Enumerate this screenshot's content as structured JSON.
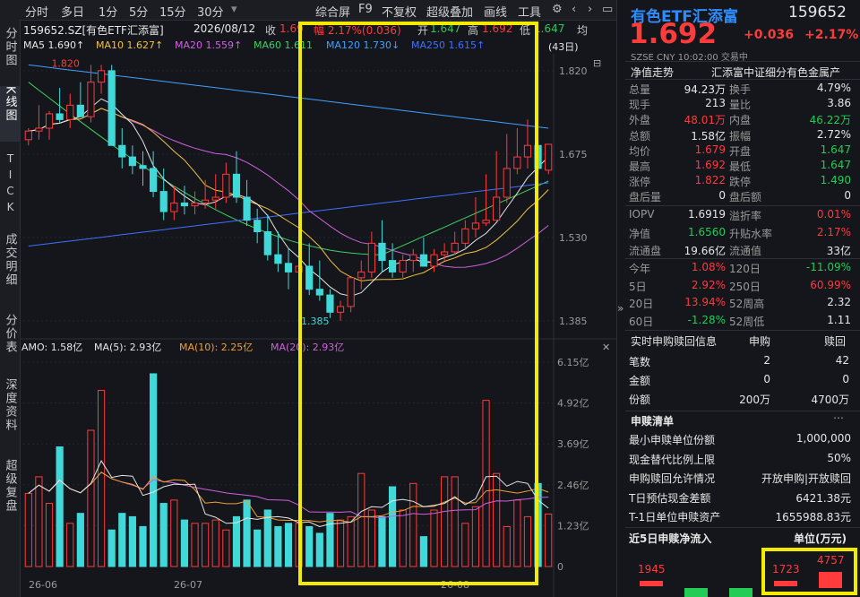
{
  "toolbar": {
    "tabs": [
      "分时",
      "多日",
      "1分",
      "5分",
      "15分",
      "30分"
    ],
    "right": [
      "综合屏",
      "F9",
      "不复权",
      "超级叠加",
      "画线",
      "工具"
    ]
  },
  "leftbar": [
    {
      "label": "分时图",
      "active": false
    },
    {
      "label": "K线图",
      "active": true
    },
    {
      "label": "TICK",
      "active": false
    },
    {
      "label": "成交明细",
      "active": false
    },
    {
      "label": "分价表",
      "active": false
    },
    {
      "label": "深度资料",
      "active": false
    },
    {
      "label": "超级复盘",
      "active": false
    }
  ],
  "info": {
    "symbol": "159652.SZ[有色ETF汇添富]",
    "date": "2026/08/12",
    "close_label": "收",
    "close_value": "1.69",
    "change_text": "幅 2.17%(0.036)",
    "open_label": "开",
    "open_value": "1.647",
    "high_label": "高",
    "high_value": "1.692",
    "low_label": "低",
    "low_value": "1.647",
    "avg_label": "均",
    "period_badge": "(43日)"
  },
  "ma_legend": [
    {
      "name": "MA5",
      "value": "1.690↑",
      "color": "#e6e6e6"
    },
    {
      "name": "MA10",
      "value": "1.627↑",
      "color": "#f0c040"
    },
    {
      "name": "MA20",
      "value": "1.559↑",
      "color": "#d060e0"
    },
    {
      "name": "MA60",
      "value": "1.611",
      "color": "#40d060"
    },
    {
      "name": "MA120",
      "value": "1.730↓",
      "color": "#40a0ff"
    },
    {
      "name": "MA250",
      "value": "1.615↑",
      "color": "#4070ff"
    }
  ],
  "vol_legend": [
    {
      "name": "AMO:",
      "value": "1.58亿",
      "color": "#e6e6e6"
    },
    {
      "name": "MA(5):",
      "value": "2.93亿",
      "color": "#e6e6e6"
    },
    {
      "name": "MA(10):",
      "value": "2.25亿",
      "color": "#f0a030"
    },
    {
      "name": "MA(20):",
      "value": "2.93亿",
      "color": "#d060e0"
    }
  ],
  "price_axis": [
    "1.820",
    "1.675",
    "1.530",
    "1.385"
  ],
  "vol_axis": [
    "6.15亿",
    "4.92亿",
    "3.69亿",
    "2.46亿",
    "1.23亿",
    "0"
  ],
  "date_axis": [
    "26-06",
    "26-07",
    "26-08"
  ],
  "annotations": {
    "high": "1.820",
    "low": "1.385"
  },
  "chart_data": {
    "type": "candlestick",
    "x": [
      1,
      2,
      3,
      4,
      5,
      6,
      7,
      8,
      9,
      10,
      11,
      12,
      13,
      14,
      15,
      16,
      17,
      18,
      19,
      20,
      21,
      22,
      23,
      24,
      25,
      26,
      27,
      28,
      29,
      30,
      31,
      32,
      33,
      34,
      35,
      36,
      37,
      38,
      39,
      40,
      41,
      42,
      43
    ],
    "open": [
      1.7,
      1.715,
      1.72,
      1.745,
      1.735,
      1.76,
      1.74,
      1.8,
      1.82,
      1.69,
      1.67,
      1.655,
      1.65,
      1.61,
      1.575,
      1.59,
      1.585,
      1.59,
      1.595,
      1.6,
      1.64,
      1.6,
      1.56,
      1.54,
      1.5,
      1.485,
      1.47,
      1.48,
      1.44,
      1.43,
      1.4,
      1.41,
      1.46,
      1.47,
      1.52,
      1.49,
      1.47,
      1.49,
      1.5,
      1.48,
      1.5,
      1.505,
      1.52,
      1.545,
      1.555,
      1.56,
      1.6,
      1.65,
      1.67,
      1.69,
      1.647
    ],
    "high": [
      1.72,
      1.76,
      1.75,
      1.79,
      1.78,
      1.8,
      1.83,
      1.83,
      1.83,
      1.72,
      1.69,
      1.68,
      1.68,
      1.65,
      1.62,
      1.62,
      1.61,
      1.63,
      1.64,
      1.66,
      1.68,
      1.63,
      1.58,
      1.57,
      1.54,
      1.51,
      1.5,
      1.52,
      1.49,
      1.44,
      1.42,
      1.46,
      1.49,
      1.54,
      1.56,
      1.52,
      1.5,
      1.51,
      1.53,
      1.51,
      1.52,
      1.54,
      1.56,
      1.6,
      1.64,
      1.68,
      1.71,
      1.72,
      1.735,
      1.7,
      1.692
    ],
    "low": [
      1.69,
      1.7,
      1.7,
      1.73,
      1.72,
      1.74,
      1.73,
      1.78,
      1.69,
      1.65,
      1.64,
      1.62,
      1.6,
      1.56,
      1.56,
      1.57,
      1.57,
      1.58,
      1.58,
      1.59,
      1.59,
      1.55,
      1.52,
      1.49,
      1.47,
      1.44,
      1.44,
      1.43,
      1.42,
      1.39,
      1.385,
      1.4,
      1.44,
      1.46,
      1.47,
      1.46,
      1.46,
      1.47,
      1.48,
      1.47,
      1.49,
      1.5,
      1.51,
      1.53,
      1.55,
      1.56,
      1.59,
      1.64,
      1.65,
      1.64,
      1.64
    ],
    "close": [
      1.715,
      1.72,
      1.745,
      1.735,
      1.76,
      1.74,
      1.8,
      1.82,
      1.69,
      1.67,
      1.655,
      1.65,
      1.61,
      1.575,
      1.59,
      1.585,
      1.59,
      1.595,
      1.6,
      1.64,
      1.6,
      1.56,
      1.54,
      1.5,
      1.485,
      1.47,
      1.48,
      1.44,
      1.43,
      1.4,
      1.41,
      1.46,
      1.47,
      1.52,
      1.49,
      1.47,
      1.49,
      1.5,
      1.48,
      1.5,
      1.505,
      1.52,
      1.545,
      1.555,
      1.56,
      1.6,
      1.65,
      1.67,
      1.69,
      1.65,
      1.692
    ],
    "amount_yi": [
      2.2,
      2.7,
      1.9,
      3.6,
      1.3,
      1.6,
      4.1,
      5.3,
      1.1,
      1.6,
      1.5,
      1.2,
      5.8,
      1.9,
      2.0,
      1.4,
      1.3,
      1.3,
      1.4,
      1.1,
      1.5,
      2.0,
      1.1,
      1.7,
      1.2,
      1.3,
      1.3,
      1.2,
      1.0,
      1.6,
      1.4,
      1.5,
      2.8,
      1.7,
      1.5,
      2.4,
      1.7,
      2.5,
      0.9,
      1.7,
      2.7,
      2.7,
      1.3,
      1.8,
      5.0,
      2.8,
      1.2,
      2.0,
      1.5,
      2.5,
      1.58
    ],
    "ylim": [
      1.36,
      1.84
    ],
    "vol_ylim": [
      0,
      6.15
    ]
  },
  "right": {
    "title": "有色ETF汇添富",
    "code": "159652",
    "price": "1.692",
    "change": "+0.036",
    "change_pct": "+2.17%",
    "market_line": "SZSE  CNY  10:02:00  交易中",
    "nav_trend_label": "净值走势",
    "index_name": "汇添富中证细分有色金属产",
    "rows_a": [
      [
        "总量",
        "94.23万",
        "white",
        "换手",
        "4.79%",
        "white"
      ],
      [
        "现手",
        "213",
        "white",
        "量比",
        "3.86",
        "white"
      ],
      [
        "外盘",
        "48.01万",
        "red",
        "内盘",
        "46.22万",
        "green"
      ],
      [
        "总额",
        "1.58亿",
        "white",
        "振幅",
        "2.72%",
        "white"
      ],
      [
        "均价",
        "1.679",
        "red",
        "开盘",
        "1.647",
        "green"
      ],
      [
        "最高",
        "1.692",
        "red",
        "最低",
        "1.647",
        "green"
      ],
      [
        "涨停",
        "1.822",
        "red",
        "跌停",
        "1.490",
        "green"
      ],
      [
        "盘后量",
        "0",
        "white",
        "盘后额",
        "0",
        "white"
      ]
    ],
    "rows_b": [
      [
        "IOPV",
        "1.6919",
        "white",
        "溢折率",
        "0.01%",
        "red"
      ],
      [
        "净值",
        "1.6560",
        "green",
        "升贴水率",
        "2.17%",
        "red"
      ],
      [
        "流通盘",
        "19.66亿",
        "white",
        "流通值",
        "33亿",
        "white"
      ]
    ],
    "rows_c": [
      [
        "今年",
        "1.08%",
        "red",
        "120日",
        "-11.09%",
        "green"
      ],
      [
        "5日",
        "2.92%",
        "red",
        "250日",
        "60.99%",
        "red"
      ],
      [
        "20日",
        "13.94%",
        "red",
        "52周高",
        "2.32",
        "white"
      ],
      [
        "60日",
        "-1.28%",
        "green",
        "52周低",
        "1.11",
        "white"
      ]
    ],
    "sub_header": [
      "实时申购赎回信息",
      "申购",
      "赎回"
    ],
    "sub_rows": [
      [
        "笔数",
        "2",
        "42"
      ],
      [
        "金额",
        "0",
        "0"
      ],
      [
        "份额",
        "200万",
        "4700万"
      ]
    ],
    "list_title": "申赎清单",
    "list_rows": [
      [
        "最小申赎单位份额",
        "1,000,000"
      ],
      [
        "现金替代比例上限",
        "50%"
      ],
      [
        "申购赎回允许情况",
        "开放申购|开放赎回"
      ],
      [
        "T日预估现金差额",
        "6421.38元"
      ],
      [
        "T-1日单位申赎资产",
        "1655988.83元"
      ]
    ],
    "flow_title": "近5日申赎净流入",
    "flow_unit": "单位(万元)",
    "flow_values": [
      1945,
      -300,
      -250,
      1723,
      4757
    ],
    "flow_labels": [
      "1945",
      "1723",
      "4757"
    ]
  }
}
